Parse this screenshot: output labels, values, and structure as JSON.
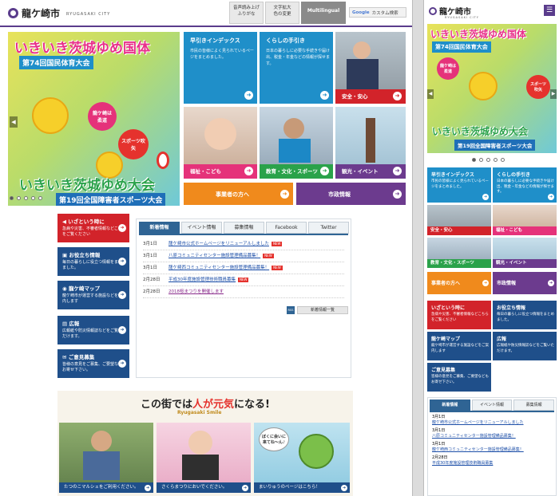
{
  "site": {
    "name": "龍ケ崎市",
    "name_en": "RYUGASAKI CITY"
  },
  "header": {
    "read_aloud": "音声読み上げ",
    "furigana": "ふりがな",
    "text_enlarge": "文字拡大",
    "color_change": "色の変更",
    "multilingual": "Multilingual",
    "search_brand": "Google",
    "search_placeholder": "カスタム検索"
  },
  "hero": {
    "title_top": "いきいき茨城ゆめ国体",
    "badge_top": "第74回国民体育大会",
    "bubble_judo": "龍ケ崎は柔道",
    "bubble_fukiya": "スポーツ吹矢",
    "title_bottom": "いきいき茨城ゆめ大会",
    "badge_bottom": "第19回全国障害者スポーツ大会",
    "prev": "◀",
    "next": "▶"
  },
  "tiles": {
    "quick_index": {
      "title": "早引きインデックス",
      "desc": "市民の皆様によく見られているページをまとめました。"
    },
    "living": {
      "title": "くらしの手引き",
      "desc": "日本の暮らしに必要な手続きや届け出、税金・年金などの情報が探せます。"
    },
    "safety": "安全・安心",
    "welfare": "福祉・こども",
    "education": "教育・文化・スポーツ",
    "tourism": "観光・イベント",
    "business": "事業者の方へ",
    "city": "市政情報"
  },
  "side": [
    {
      "title": "いざという時に",
      "desc": "急病や災害、不審者情報などこちらをご覧ください",
      "color": "#d2232a"
    },
    {
      "title": "お役立ち情報",
      "desc": "毎日の暮らしに役立つ情報をまとめました。",
      "color": "#1f4f8a"
    },
    {
      "title": "龍ケ崎マップ",
      "desc": "龍ケ崎市が運営する施設などをご案内します",
      "color": "#1f4f8a"
    },
    {
      "title": "広報",
      "desc": "広報紙や防災情報誌などをご覧いただけます。",
      "color": "#1f4f8a"
    },
    {
      "title": "ご意見募集",
      "desc": "皆様の意見をご募集、ご要望などもお寄せ下さい。",
      "color": "#1f4f8a"
    }
  ],
  "news": {
    "tabs": [
      "新着情報",
      "イベント情報",
      "募集情報",
      "Facebook",
      "Twitter"
    ],
    "items": [
      {
        "date": "3月1日",
        "title": "龍ケ崎市公式ホームページをリニューアルしました",
        "is_new": true
      },
      {
        "date": "3月1日",
        "title": "八原コミュニティセンター施設管理備品募集！",
        "is_new": true
      },
      {
        "date": "3月1日",
        "title": "龍ケ崎西コミュニティセンター施設管理備品募集！",
        "is_new": true
      },
      {
        "date": "2月28日",
        "title": "平成30年度施設管理技術職員募集",
        "is_new": true
      },
      {
        "date": "2月28日",
        "title": "2018桜まつりを開催します",
        "is_new": false
      }
    ],
    "new_label": "NEW",
    "rss": "RSS",
    "more": "新着情報一覧"
  },
  "smile": {
    "title_pre": "この街では",
    "title_hl": "人が元気",
    "title_post": "になる!",
    "subtitle": "Ryugasaki Smile",
    "speech": "ぼくに会いに来てね～ん♪",
    "cards": [
      "たつのこマルシェをご利用ください。",
      "さくらまつりにおいでください。",
      "まいりゅうのページはこちら！"
    ]
  },
  "mobile": {
    "menu_icon": "☰",
    "dots_count": 5,
    "news_tabs": [
      "新着情報",
      "イベント情報",
      "募集情報"
    ],
    "news_items": [
      {
        "date": "3月1日",
        "title": "龍ケ崎市公式ホームページをリニューアルしました"
      },
      {
        "date": "3月1日",
        "title": "八原コミュニティセンター施設管理備品募集！"
      },
      {
        "date": "3月1日",
        "title": "龍ケ崎西コミュニティセンター施設管理備品募集！"
      },
      {
        "date": "2月28日",
        "title": "平成30年度施設管理技術職員募集"
      }
    ]
  },
  "colors": {
    "purple": "#5a3c8c",
    "blue": "#1f8fc9",
    "red": "#d2232a",
    "navy": "#1f4f8a",
    "green": "#2aa24a",
    "pink": "#e5327a",
    "orange": "#f08a1c",
    "violet": "#6c3b8e"
  }
}
